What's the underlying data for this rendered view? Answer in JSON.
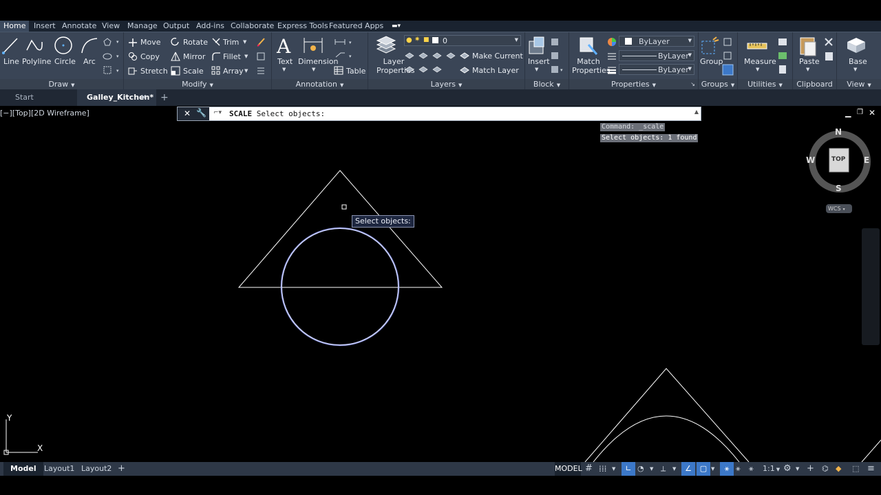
{
  "ribbon_tabs": [
    "Home",
    "Insert",
    "Annotate",
    "View",
    "Manage",
    "Output",
    "Add-ins",
    "Collaborate",
    "Express Tools",
    "Featured Apps"
  ],
  "panels": {
    "draw": {
      "title": "Draw",
      "line": "Line",
      "polyline": "Polyline",
      "circle": "Circle",
      "arc": "Arc"
    },
    "modify": {
      "title": "Modify",
      "move": "Move",
      "rotate": "Rotate",
      "trim": "Trim",
      "copy": "Copy",
      "mirror": "Mirror",
      "fillet": "Fillet",
      "stretch": "Stretch",
      "scale": "Scale",
      "array": "Array"
    },
    "annotation": {
      "title": "Annotation",
      "text": "Text",
      "dimension": "Dimension",
      "table": "Table"
    },
    "layers": {
      "title": "Layers",
      "layer_properties": "Layer Properties",
      "layer_value": "0",
      "make_current": "Make Current",
      "match_layer": "Match Layer"
    },
    "block": {
      "title": "Block",
      "insert": "Insert"
    },
    "properties": {
      "title": "Properties",
      "match_properties": "Match Properties",
      "color": "ByLayer",
      "linetype": "ByLayer",
      "lineweight": "ByLayer"
    },
    "groups": {
      "title": "Groups",
      "group": "Group"
    },
    "utilities": {
      "title": "Utilities",
      "measure": "Measure"
    },
    "clipboard": {
      "title": "Clipboard",
      "paste": "Paste"
    },
    "view": {
      "title": "View",
      "base": "Base"
    }
  },
  "doc_tabs": {
    "start": "Start",
    "active": "Galley_Kitchen*"
  },
  "viewport_label": "[−][Top][2D Wireframe]",
  "command": {
    "name": "SCALE",
    "prompt": " Select objects:"
  },
  "history": [
    "Command: _scale",
    "Select objects: 1 found"
  ],
  "tooltip": "Select objects:",
  "navcube": {
    "top": "TOP",
    "n": "N",
    "s": "S",
    "e": "E",
    "w": "W",
    "ucs": "WCS"
  },
  "ucs_icon": {
    "x": "X",
    "y": "Y"
  },
  "layout_tabs": {
    "model": "Model",
    "layout1": "Layout1",
    "layout2": "Layout2"
  },
  "status": {
    "model": "MODEL",
    "scale": "1:1"
  },
  "colors": {
    "ribbon": "#3a4556",
    "canvas": "#000000",
    "highlight": "#c9d0ff"
  }
}
